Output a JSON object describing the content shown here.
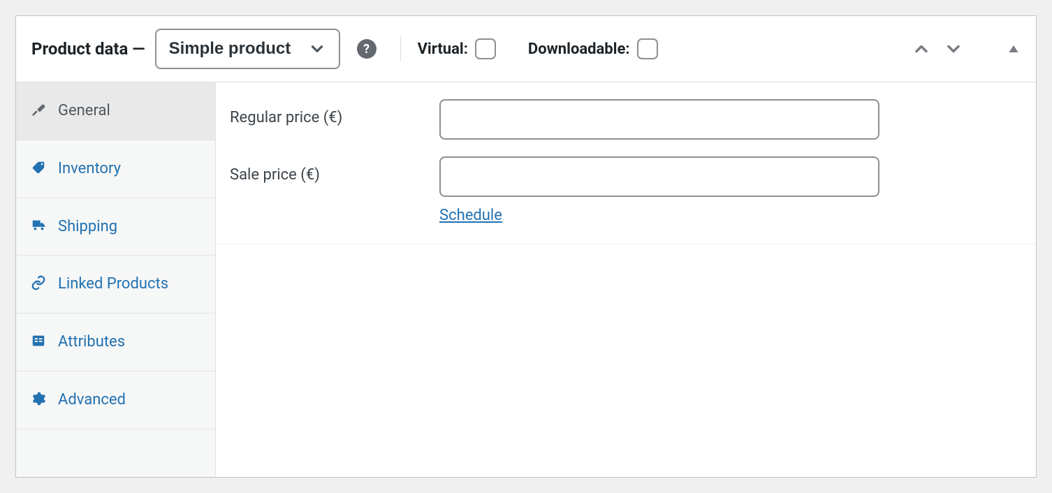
{
  "header": {
    "title": "Product data —",
    "type_select": {
      "selected": "Simple product",
      "options": [
        "Simple product"
      ]
    },
    "help_icon": "?",
    "virtual_label": "Virtual:",
    "virtual_checked": false,
    "downloadable_label": "Downloadable:",
    "downloadable_checked": false
  },
  "tabs": [
    {
      "id": "general",
      "label": "General",
      "icon": "wrench-icon",
      "active": true
    },
    {
      "id": "inventory",
      "label": "Inventory",
      "icon": "tag-icon",
      "active": false
    },
    {
      "id": "shipping",
      "label": "Shipping",
      "icon": "truck-icon",
      "active": false
    },
    {
      "id": "linked",
      "label": "Linked Products",
      "icon": "link-icon",
      "active": false
    },
    {
      "id": "attributes",
      "label": "Attributes",
      "icon": "list-icon",
      "active": false
    },
    {
      "id": "advanced",
      "label": "Advanced",
      "icon": "gear-icon",
      "active": false
    }
  ],
  "general": {
    "regular_price_label": "Regular price (€)",
    "regular_price_value": "",
    "sale_price_label": "Sale price (€)",
    "sale_price_value": "",
    "schedule_label": "Schedule"
  },
  "colors": {
    "link": "#2271b1",
    "border": "#8c8f94",
    "panel_border": "#c3c4c7",
    "bg": "#f0f0f1",
    "tab_active_bg": "#e9e9ea",
    "text": "#1d2327",
    "muted": "#646970"
  }
}
